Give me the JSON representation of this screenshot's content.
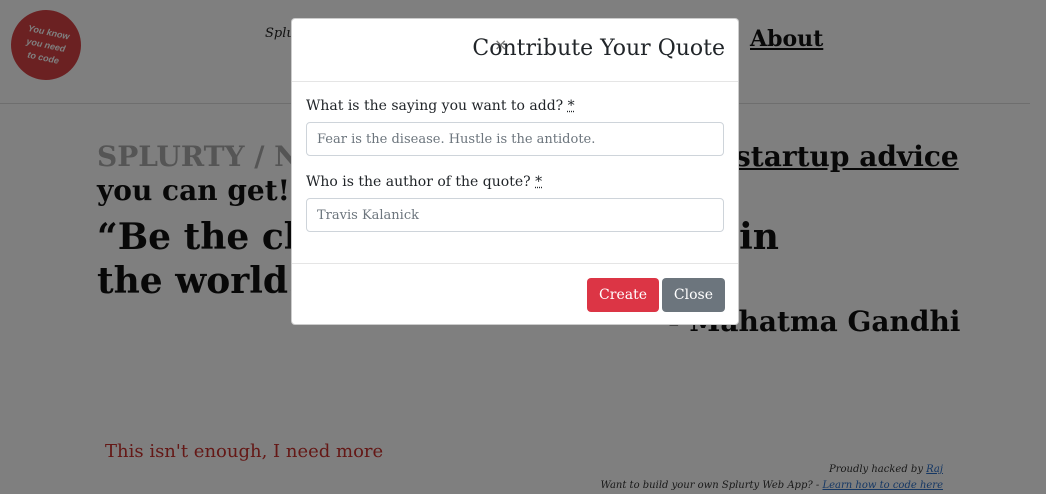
{
  "page": {
    "logo_text": "You know you need to code",
    "nav_left": "Splurty",
    "nav_about": "About",
    "headline_grey": "SPLURTY / NO",
    "headline_link": "startup advice",
    "subline": "you can get!",
    "quote": "“Be the change you wish to see in the world.”",
    "quote_author": "- Mahatma Gandhi",
    "more_link": "This isn't enough, I need more",
    "footer": {
      "hacked_by_prefix": "Proudly hacked by",
      "hacked_by_name": "Raj",
      "build_prefix": "Want to build your own Splurty Web App? -",
      "build_link": "Learn how to code here"
    }
  },
  "modal": {
    "close_icon": "×",
    "title": "Contribute Your Quote",
    "saying_label": "What is the saying you want to add?",
    "saying_placeholder": "Fear is the disease. Hustle is the antidote.",
    "author_label": "Who is the author of the quote?",
    "author_placeholder": "Travis Kalanick",
    "required_mark": "*",
    "create_label": "Create",
    "close_label": "Close"
  },
  "colors": {
    "create": "#dc3545",
    "close": "#6c757d",
    "logo": "#d64245",
    "more_link": "#c9302c"
  }
}
